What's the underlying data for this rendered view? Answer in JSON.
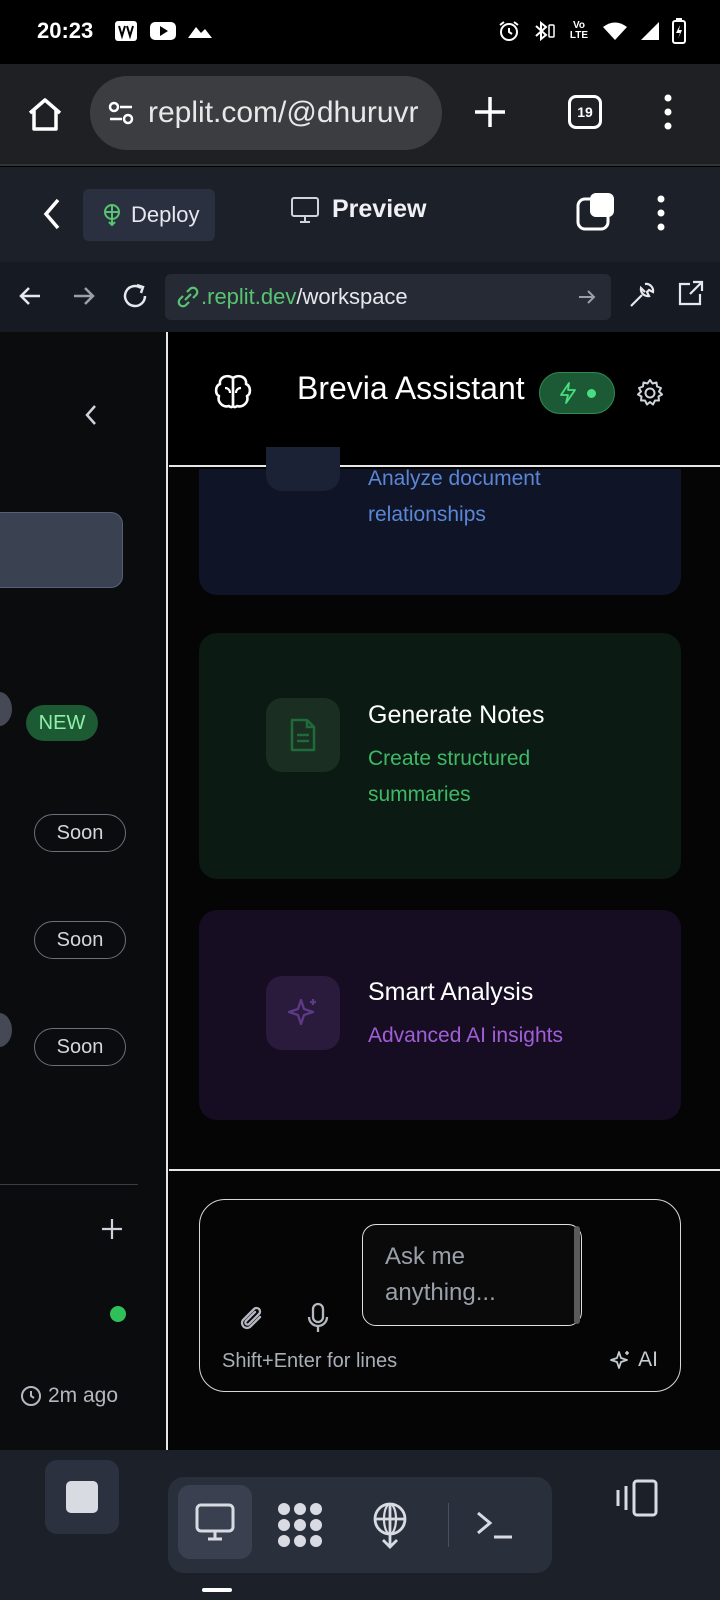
{
  "status_bar": {
    "time": "20:23",
    "network": "Vo LTE"
  },
  "browser": {
    "url": "replit.com/@dhuruvr",
    "tabs_count": "19"
  },
  "replit": {
    "deploy_label": "Deploy",
    "preview_label": "Preview",
    "address": {
      "domain": ".replit.dev",
      "path": "/workspace"
    }
  },
  "sidebar": {
    "new_badge": "NEW",
    "soon_badges": [
      "Soon",
      "Soon",
      "Soon"
    ],
    "last_updated": "2m ago"
  },
  "assistant": {
    "title": "Brevia Assistant",
    "cards": [
      {
        "title": "",
        "description": "Analyze document relationships",
        "accent": "#5b86d6"
      },
      {
        "title": "Generate Notes",
        "description": "Create structured summaries",
        "accent": "#3fb866"
      },
      {
        "title": "Smart Analysis",
        "description": "Advanced AI insights",
        "accent": "#a05fd8"
      }
    ],
    "composer": {
      "placeholder": "Ask me anything...",
      "hint": "Shift+Enter for lines",
      "ai_label": "AI"
    }
  }
}
